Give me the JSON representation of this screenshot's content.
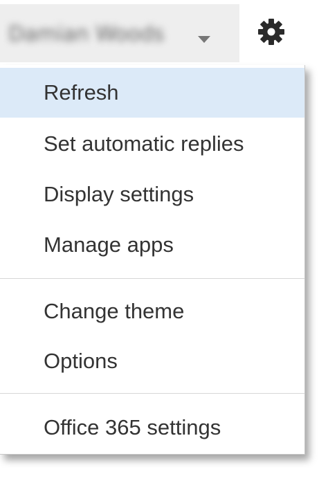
{
  "header": {
    "account_name": "Damian Woods",
    "account_chevron_icon": "chevron-down-icon",
    "settings_icon": "gear-icon"
  },
  "menu": {
    "groups": [
      {
        "items": [
          {
            "label": "Refresh",
            "highlighted": true
          },
          {
            "label": "Set automatic replies",
            "highlighted": false
          },
          {
            "label": "Display settings",
            "highlighted": false
          },
          {
            "label": "Manage apps",
            "highlighted": false
          }
        ]
      },
      {
        "items": [
          {
            "label": "Change theme",
            "highlighted": false
          },
          {
            "label": "Options",
            "highlighted": false
          }
        ]
      },
      {
        "items": [
          {
            "label": "Office 365 settings",
            "highlighted": false
          }
        ]
      }
    ]
  },
  "colors": {
    "highlight": "#dceaf8",
    "text": "#333333",
    "divider": "#d6d6d6"
  }
}
